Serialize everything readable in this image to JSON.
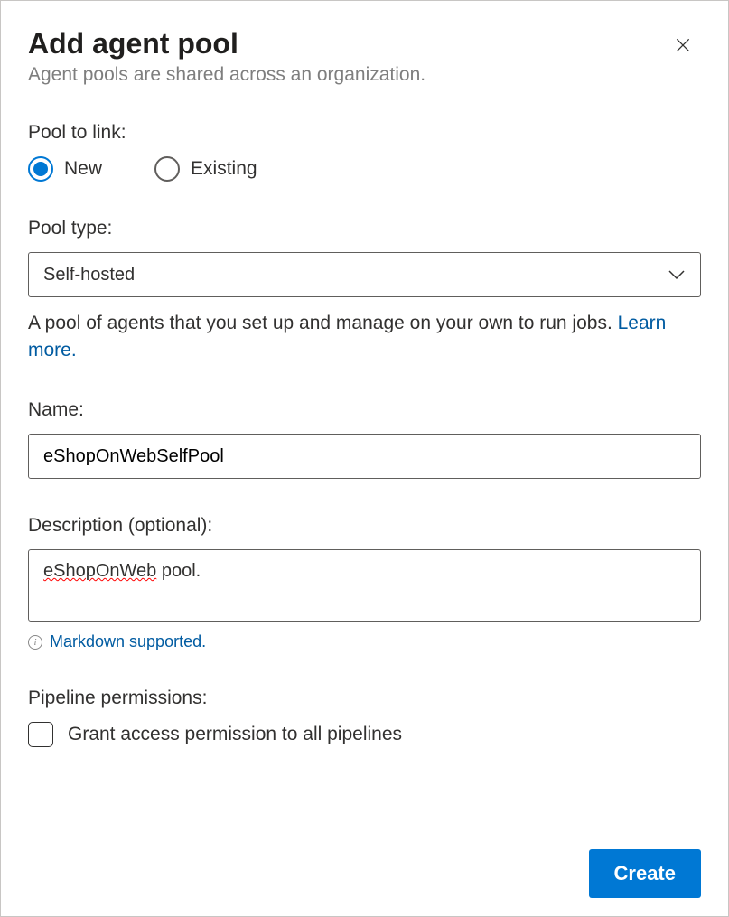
{
  "header": {
    "title": "Add agent pool",
    "subtitle": "Agent pools are shared across an organization."
  },
  "poolToLink": {
    "label": "Pool to link:",
    "options": [
      {
        "label": "New",
        "selected": true
      },
      {
        "label": "Existing",
        "selected": false
      }
    ]
  },
  "poolType": {
    "label": "Pool type:",
    "value": "Self-hosted",
    "helperPrefix": "A pool of agents that you set up and manage on your own to run jobs. ",
    "learnMore": "Learn more."
  },
  "name": {
    "label": "Name:",
    "value": "eShopOnWebSelfPool"
  },
  "description": {
    "label": "Description (optional):",
    "valueMisspelled": "eShopOnWeb",
    "valueRest": " pool.",
    "markdownHint": "Markdown supported."
  },
  "permissions": {
    "label": "Pipeline permissions:",
    "checkboxLabel": "Grant access permission to all pipelines",
    "checked": false
  },
  "footer": {
    "createLabel": "Create"
  }
}
